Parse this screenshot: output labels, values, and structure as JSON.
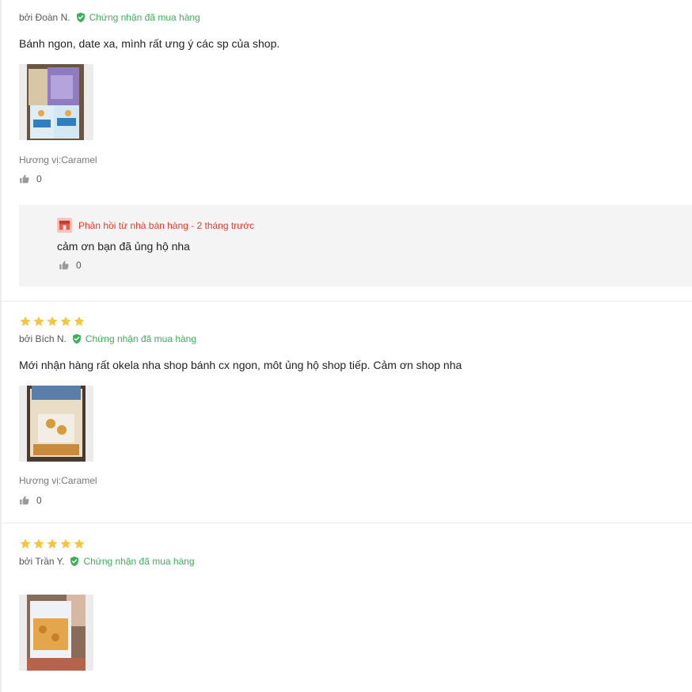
{
  "reviews": [
    {
      "author": "bởi Đoàn N.",
      "verified": "Chứng nhận đã mua hàng",
      "content": "Bánh ngon, date xa, mình rất ưng ý các sp của shop.",
      "variant": "Hương vị:Caramel",
      "likes": "0",
      "reply": {
        "header": "Phản hồi từ nhà bán hàng - 2 tháng trước",
        "text": "cảm ơn bạn đã ủng hộ nha",
        "likes": "0"
      }
    },
    {
      "rating": 5,
      "author": "bởi Bích N.",
      "verified": "Chứng nhận đã mua hàng",
      "content": "Mới nhận hàng rất okela nha shop bánh cx ngon, môt ủng hộ shop tiếp. Cảm ơn shop nha",
      "variant": "Hương vị:Caramel",
      "likes": "0"
    },
    {
      "rating": 5,
      "author": "bởi Trần Y.",
      "verified": "Chứng nhận đã mua hàng"
    }
  ],
  "colors": {
    "star": "#f5c542",
    "verified": "#3eae5a",
    "reply": "#e03e2d",
    "reply_bg": "#f4f4f4"
  },
  "icons": [
    "star-icon",
    "verified-shield-icon",
    "thumbs-up-icon",
    "shop-icon"
  ]
}
